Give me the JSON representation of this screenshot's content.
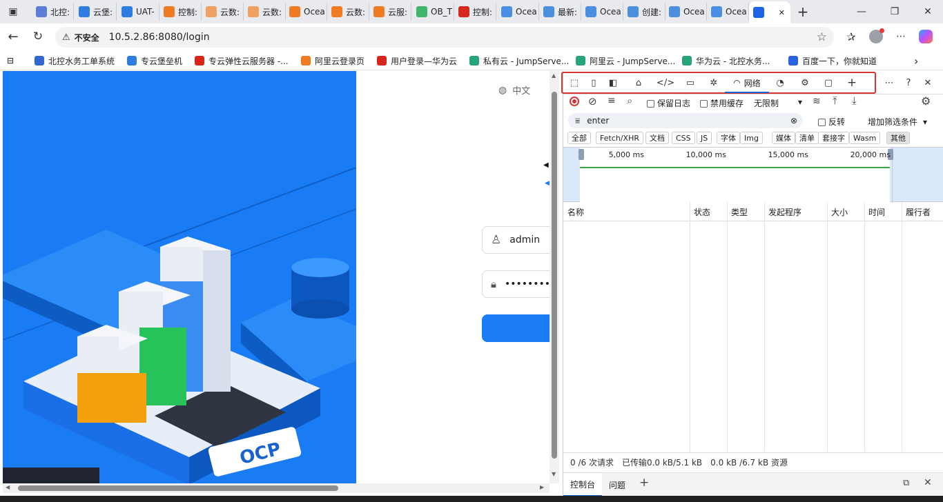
{
  "tabs": [
    {
      "label": "北控:",
      "color": "#5b7fd6"
    },
    {
      "label": "云堡:",
      "color": "#2f7de1"
    },
    {
      "label": "UAT-",
      "color": "#2f7de1"
    },
    {
      "label": "控制:",
      "color": "#f07b22"
    },
    {
      "label": "云数:",
      "color": "#f0a060"
    },
    {
      "label": "云数:",
      "color": "#f0a060"
    },
    {
      "label": "Ocea",
      "color": "#f07b22"
    },
    {
      "label": "云数:",
      "color": "#f07b22"
    },
    {
      "label": "云服:",
      "color": "#f07b22"
    },
    {
      "label": "OB_T",
      "color": "#3fb66b"
    },
    {
      "label": "控制:",
      "color": "#d7261c"
    },
    {
      "label": "Ocea",
      "color": "#4a8fe0"
    },
    {
      "label": "最新:",
      "color": "#4a8fe0"
    },
    {
      "label": "Ocea",
      "color": "#4a8fe0"
    },
    {
      "label": "创建:",
      "color": "#4a8fe0"
    },
    {
      "label": "Ocea",
      "color": "#4a8fe0"
    },
    {
      "label": "Ocea",
      "color": "#4a8fe0"
    },
    {
      "label": "",
      "color": "#1e62e6"
    }
  ],
  "address": {
    "security": "不安全",
    "url": "10.5.2.86:8080/login"
  },
  "bookmarks": [
    {
      "label": "北控水务工单系统",
      "color": "#3366cc"
    },
    {
      "label": "专云堡垒机",
      "color": "#2f7de1"
    },
    {
      "label": "专云弹性云服务器 -...",
      "color": "#d7261c"
    },
    {
      "label": "阿里云登录页",
      "color": "#f07b22"
    },
    {
      "label": "用户登录—华为云",
      "color": "#d7261c"
    },
    {
      "label": "私有云 - JumpServe...",
      "color": "#29a37a"
    },
    {
      "label": "阿里云 - JumpServe...",
      "color": "#29a37a"
    },
    {
      "label": "华为云 - 北控水务...",
      "color": "#29a37a"
    },
    {
      "label": "百度一下，你就知道",
      "color": "#2b5fe0"
    }
  ],
  "login": {
    "lang": "中文",
    "username": "admin",
    "password": "•••••••••••",
    "illustration_label": "OCP"
  },
  "devtools": {
    "network_tab": "网络",
    "preserve_log": "保留日志",
    "disable_cache": "禁用缓存",
    "throttle": "无限制",
    "filter_value": "enter",
    "invert": "反转",
    "add_filter": "增加筛选条件",
    "chips": [
      "全部",
      "Fetch/XHR",
      "文档",
      "CSS",
      "JS",
      "字体",
      "Img",
      "媒体",
      "清单",
      "套接字",
      "Wasm",
      "其他"
    ],
    "timeline_ticks": [
      "5,000 ms",
      "10,000 ms",
      "15,000 ms",
      "20,000 ms"
    ],
    "columns": [
      "名称",
      "状态",
      "类型",
      "发起程序",
      "大小",
      "时间",
      "履行者"
    ],
    "status_requests": "0 /6 次请求",
    "status_transferred": "已传输0.0 kB/5.1 kB",
    "status_resources": "0.0 kB /6.7 kB 资源",
    "drawer_console": "控制台",
    "drawer_issues": "问题"
  }
}
